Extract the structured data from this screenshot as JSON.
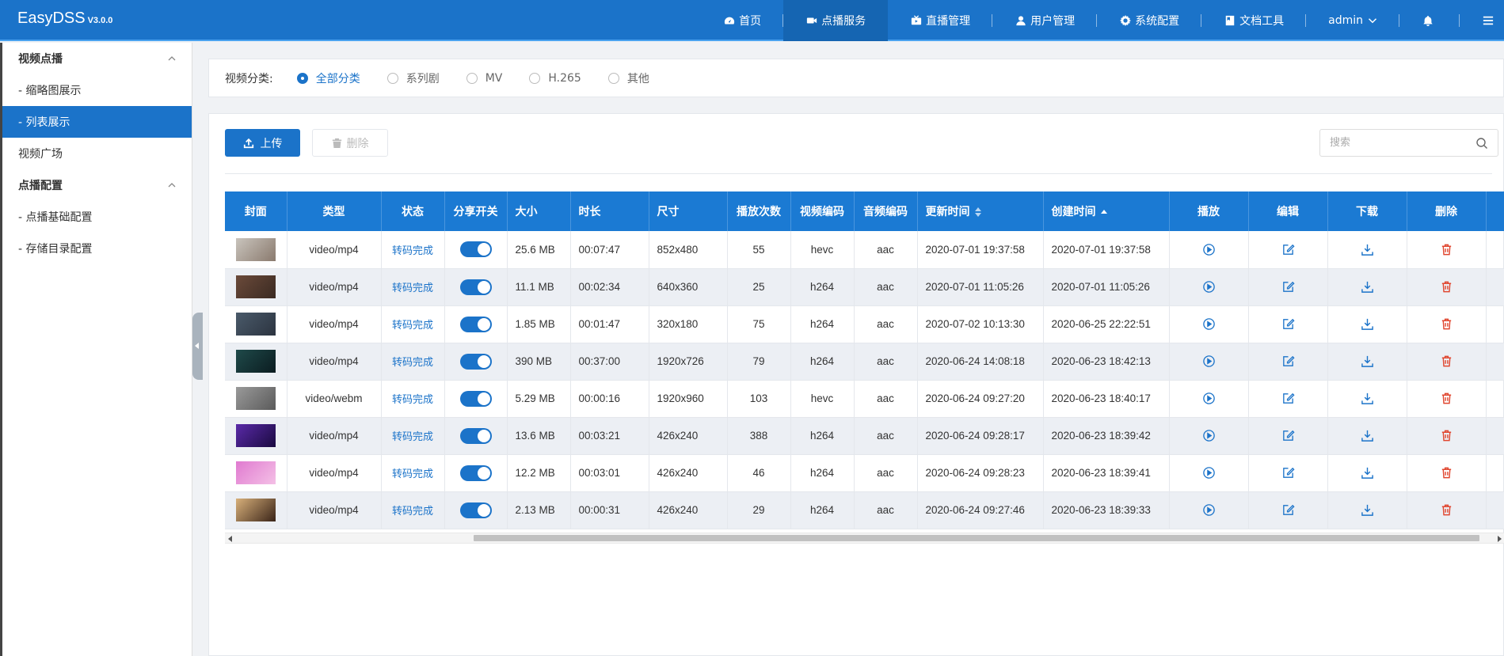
{
  "app": {
    "name": "EasyDSS",
    "version": "V3.0.0"
  },
  "topnav": [
    {
      "label": "首页",
      "icon": "dashboard-icon",
      "active": false
    },
    {
      "label": "点播服务",
      "icon": "video-camera-icon",
      "active": true
    },
    {
      "label": "直播管理",
      "icon": "live-icon",
      "active": false
    },
    {
      "label": "用户管理",
      "icon": "user-icon",
      "active": false
    },
    {
      "label": "系统配置",
      "icon": "gear-icon",
      "active": false
    },
    {
      "label": "文档工具",
      "icon": "document-icon",
      "active": false
    }
  ],
  "user": {
    "name": "admin"
  },
  "sidebar": {
    "group1": "视频点播",
    "item1": "- 缩略图展示",
    "item2": "- 列表展示",
    "item3": "视频广场",
    "group2": "点播配置",
    "item4": "- 点播基础配置",
    "item5": "- 存储目录配置"
  },
  "filter": {
    "label": "视频分类:",
    "options": [
      "全部分类",
      "系列剧",
      "MV",
      "H.265",
      "其他"
    ],
    "selected": "全部分类"
  },
  "toolbar": {
    "upload": "上传",
    "delete": "删除",
    "search_placeholder": "搜索"
  },
  "table": {
    "headers": [
      "封面",
      "类型",
      "状态",
      "分享开关",
      "大小",
      "时长",
      "尺寸",
      "播放次数",
      "视频编码",
      "音频编码",
      "更新时间",
      "创建时间",
      "播放",
      "编辑",
      "下载",
      "删除"
    ],
    "rows": [
      {
        "type": "video/mp4",
        "status": "转码完成",
        "share": true,
        "size": "25.6 MB",
        "duration": "00:07:47",
        "dim": "852x480",
        "plays": "55",
        "vcodec": "hevc",
        "acodec": "aac",
        "updated": "2020-07-01 19:37:58",
        "created": "2020-07-01 19:37:58",
        "thumb": [
          "#c9c4bd",
          "#8a7a6e"
        ]
      },
      {
        "type": "video/mp4",
        "status": "转码完成",
        "share": true,
        "size": "11.1 MB",
        "duration": "00:02:34",
        "dim": "640x360",
        "plays": "25",
        "vcodec": "h264",
        "acodec": "aac",
        "updated": "2020-07-01 11:05:26",
        "created": "2020-07-01 11:05:26",
        "thumb": [
          "#6b4a3a",
          "#3a2a22"
        ]
      },
      {
        "type": "video/mp4",
        "status": "转码完成",
        "share": true,
        "size": "1.85 MB",
        "duration": "00:01:47",
        "dim": "320x180",
        "plays": "75",
        "vcodec": "h264",
        "acodec": "aac",
        "updated": "2020-07-02 10:13:30",
        "created": "2020-06-25 22:22:51",
        "thumb": [
          "#4a5a6a",
          "#2c3440"
        ]
      },
      {
        "type": "video/mp4",
        "status": "转码完成",
        "share": true,
        "size": "390 MB",
        "duration": "00:37:00",
        "dim": "1920x726",
        "plays": "79",
        "vcodec": "h264",
        "acodec": "aac",
        "updated": "2020-06-24 14:08:18",
        "created": "2020-06-23 18:42:13",
        "thumb": [
          "#1f4a4a",
          "#0b1c20"
        ]
      },
      {
        "type": "video/webm",
        "status": "转码完成",
        "share": true,
        "size": "5.29 MB",
        "duration": "00:00:16",
        "dim": "1920x960",
        "plays": "103",
        "vcodec": "hevc",
        "acodec": "aac",
        "updated": "2020-06-24 09:27:20",
        "created": "2020-06-23 18:40:17",
        "thumb": [
          "#9a9a9a",
          "#5a5a5a"
        ]
      },
      {
        "type": "video/mp4",
        "status": "转码完成",
        "share": true,
        "size": "13.6 MB",
        "duration": "00:03:21",
        "dim": "426x240",
        "plays": "388",
        "vcodec": "h264",
        "acodec": "aac",
        "updated": "2020-06-24 09:28:17",
        "created": "2020-06-23 18:39:42",
        "thumb": [
          "#5a2aa8",
          "#1a0a40"
        ]
      },
      {
        "type": "video/mp4",
        "status": "转码完成",
        "share": true,
        "size": "12.2 MB",
        "duration": "00:03:01",
        "dim": "426x240",
        "plays": "46",
        "vcodec": "h264",
        "acodec": "aac",
        "updated": "2020-06-24 09:28:23",
        "created": "2020-06-23 18:39:41",
        "thumb": [
          "#e07ad0",
          "#f4c0e6"
        ]
      },
      {
        "type": "video/mp4",
        "status": "转码完成",
        "share": true,
        "size": "2.13 MB",
        "duration": "00:00:31",
        "dim": "426x240",
        "plays": "29",
        "vcodec": "h264",
        "acodec": "aac",
        "updated": "2020-06-24 09:27:46",
        "created": "2020-06-23 18:39:33",
        "thumb": [
          "#d8b07a",
          "#3a2418"
        ]
      }
    ]
  },
  "colors": {
    "primary": "#1b73c9",
    "header": "#1b7ad3",
    "danger": "#e0452e"
  }
}
